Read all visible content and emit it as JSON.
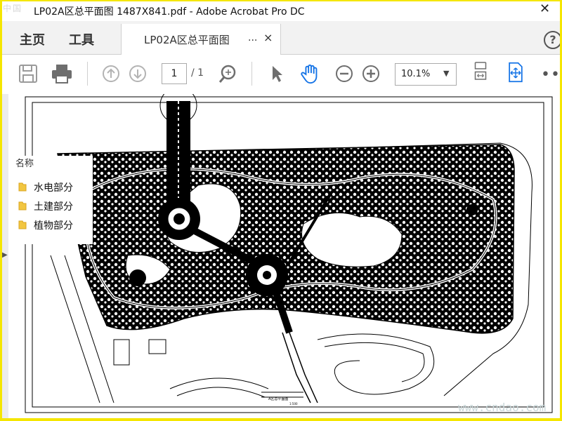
{
  "window": {
    "app_icon_text": "中国",
    "title": "LP02A区总平面图   1487X841.pdf - Adobe Acrobat Pro DC",
    "close_glyph": "✕"
  },
  "nav": {
    "home_label": "主页",
    "tools_label": "工具"
  },
  "doc_tab": {
    "label": "LP02A区总平面图",
    "more": "...",
    "close": "×"
  },
  "toolbar": {
    "page_current": "1",
    "page_total": "/ 1",
    "zoom_value": "10.1%",
    "more_glyph": "•••"
  },
  "bookmarks": {
    "header": "名称",
    "items": [
      {
        "label": "水电部分"
      },
      {
        "label": "土建部分"
      },
      {
        "label": "植物部分"
      }
    ]
  },
  "drawing": {
    "title_text": "A区总平面图",
    "scale_text": "1:500"
  },
  "watermark": "www.cndao.com",
  "colors": {
    "accent_blue": "#1473e6",
    "border_yellow": "#f5e600",
    "icon_grey": "#6e6e6e"
  }
}
